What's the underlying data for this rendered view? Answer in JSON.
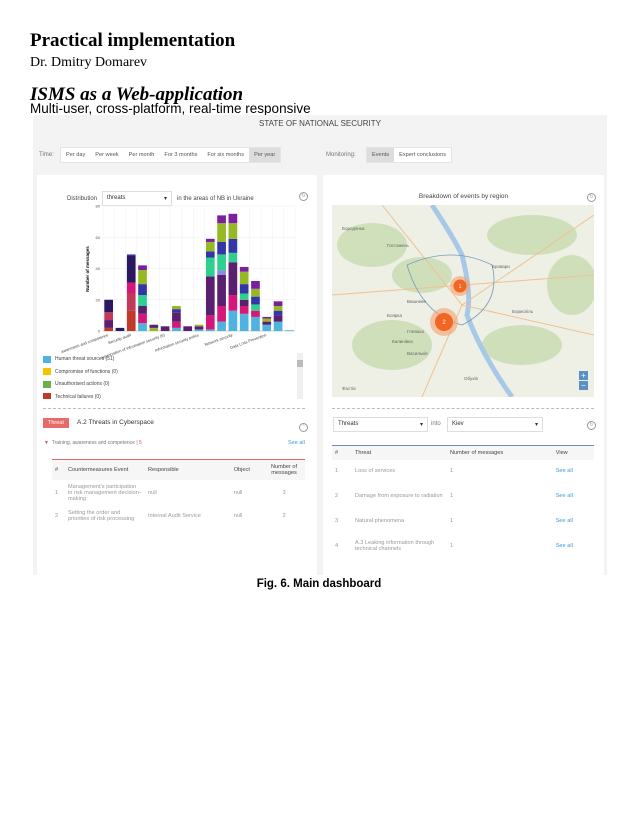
{
  "document": {
    "title": "Practical implementation",
    "author": "Dr. Dmitry Domarev",
    "section": "ISMS as a Web-application",
    "subtitle": "Multi-user, cross-platform, real-time responsive",
    "caption": "Fig. 6. Main dashboard"
  },
  "dashboard": {
    "title": "STATE OF NATIONAL SECURITY",
    "time_label": "Time:",
    "time_options": [
      "Per day",
      "Per week",
      "Per month",
      "For 3 months",
      "For six months",
      "Per year"
    ],
    "time_selected": "Per year",
    "monitoring_label": "Monitoring:",
    "monitoring_options": [
      "Events",
      "Expert conclusions"
    ],
    "monitoring_selected": "Events"
  },
  "distribution": {
    "prefix": "Distribution",
    "select_value": "threats",
    "suffix": "in the areas of NB in Ukraine",
    "legend": [
      {
        "label": "Human threat sources (51)",
        "color": "#4fb3e0"
      },
      {
        "label": "Compromise of functions (0)",
        "color": "#f5c400"
      },
      {
        "label": "Unauthorised actions (0)",
        "color": "#6ab04c"
      },
      {
        "label": "Technical failures (0)",
        "color": "#c0392b"
      }
    ]
  },
  "chart_data": {
    "type": "bar",
    "stacked": true,
    "ylabel": "Number of messages",
    "ylim": [
      0,
      80
    ],
    "yticks": [
      0,
      20,
      40,
      60,
      80
    ],
    "grid": true,
    "categories": [
      "awareness and competence",
      "",
      "Security audit",
      "",
      "",
      "organization of information security (6)",
      "",
      "",
      "Information security policy",
      "",
      "",
      "Network security",
      "",
      "",
      "Data Loss Prevention",
      "",
      ""
    ],
    "colors": {
      "lightblue": "#4fb3e0",
      "magenta": "#d6177a",
      "crimson": "#c23a5a",
      "red": "#c0392b",
      "darkpurple": "#5a1f6e",
      "navy": "#2c1860",
      "teal": "#2fd08f",
      "lavender": "#8c8ce0",
      "blue": "#3535a8",
      "olive": "#95b825",
      "purple": "#7a1fa0"
    },
    "bars": [
      [
        [
          "red",
          2
        ],
        [
          "darkpurple",
          5
        ],
        [
          "crimson",
          5
        ],
        [
          "navy",
          8
        ]
      ],
      [
        [
          "navy",
          2
        ]
      ],
      [
        [
          "red",
          13
        ],
        [
          "crimson",
          11
        ],
        [
          "magenta",
          7
        ],
        [
          "navy",
          17
        ],
        [
          "blue",
          1
        ]
      ],
      [
        [
          "lightblue",
          5
        ],
        [
          "magenta",
          6
        ],
        [
          "darkpurple",
          5
        ],
        [
          "teal",
          7
        ],
        [
          "blue",
          7
        ],
        [
          "olive",
          9
        ],
        [
          "purple",
          3
        ]
      ],
      [
        [
          "olive",
          2
        ],
        [
          "darkpurple",
          2
        ]
      ],
      [
        [
          "darkpurple",
          3
        ]
      ],
      [
        [
          "lightblue",
          2
        ],
        [
          "magenta",
          4
        ],
        [
          "darkpurple",
          6
        ],
        [
          "blue",
          2
        ],
        [
          "olive",
          2
        ]
      ],
      [
        [
          "darkpurple",
          3
        ]
      ],
      [
        [
          "lightblue",
          1
        ],
        [
          "darkpurple",
          2
        ],
        [
          "olive",
          1
        ]
      ],
      [
        [
          "lightblue",
          1
        ],
        [
          "magenta",
          9
        ],
        [
          "darkpurple",
          25
        ],
        [
          "teal",
          12
        ],
        [
          "blue",
          4
        ],
        [
          "olive",
          6
        ],
        [
          "purple",
          2
        ]
      ],
      [
        [
          "lightblue",
          6
        ],
        [
          "magenta",
          10
        ],
        [
          "darkpurple",
          20
        ],
        [
          "lavender",
          3
        ],
        [
          "teal",
          10
        ],
        [
          "blue",
          8
        ],
        [
          "olive",
          12
        ],
        [
          "purple",
          5
        ]
      ],
      [
        [
          "lightblue",
          13
        ],
        [
          "magenta",
          10
        ],
        [
          "darkpurple",
          21
        ],
        [
          "teal",
          6
        ],
        [
          "blue",
          9
        ],
        [
          "olive",
          10
        ],
        [
          "purple",
          6
        ]
      ],
      [
        [
          "lightblue",
          11
        ],
        [
          "magenta",
          5
        ],
        [
          "darkpurple",
          4
        ],
        [
          "teal",
          4
        ],
        [
          "blue",
          6
        ],
        [
          "olive",
          8
        ],
        [
          "purple",
          3
        ]
      ],
      [
        [
          "lightblue",
          9
        ],
        [
          "magenta",
          4
        ],
        [
          "teal",
          4
        ],
        [
          "blue",
          5
        ],
        [
          "olive",
          5
        ],
        [
          "purple",
          5
        ]
      ],
      [
        [
          "lightblue",
          4
        ],
        [
          "darkpurple",
          2
        ],
        [
          "olive",
          2
        ],
        [
          "purple",
          1
        ]
      ],
      [
        [
          "lightblue",
          6
        ],
        [
          "darkpurple",
          4
        ],
        [
          "blue",
          3
        ],
        [
          "olive",
          3
        ],
        [
          "purple",
          3
        ]
      ],
      [
        [
          "lightblue",
          0.5
        ]
      ]
    ]
  },
  "threat": {
    "badge": "Threat",
    "title": "A.2 Threats in Cyberspace",
    "group": "Training, awareness and competence |",
    "group_count": "5",
    "see_all": "See all",
    "headers": [
      "#",
      "Countermeasures Event",
      "Responsible",
      "Object",
      "Number of messages"
    ],
    "rows": [
      [
        "1",
        "Management's participation in risk management decision-making",
        "null",
        "null",
        "3"
      ],
      [
        "2",
        "Setting the order and priorities of risk processing",
        "Internal Audit Service",
        "null",
        "2"
      ]
    ]
  },
  "region": {
    "title": "Breakdown of events by region",
    "markers": [
      {
        "label": "1",
        "color": "#f26522"
      },
      {
        "label": "2",
        "color": "#f26522"
      }
    ],
    "map_places": [
      "Бородянка",
      "Гостомель",
      "Вишневе",
      "Боярка",
      "Бровари",
      "Бориспіль",
      "Васильків",
      "Обухів",
      "Фастів",
      "Калинівка",
      "Глеваха"
    ],
    "zoom_in": "+",
    "zoom_out": "−",
    "select1": "Threats",
    "into": "into",
    "select2": "Kiev",
    "headers": [
      "#",
      "Threat",
      "Number of messages",
      "View"
    ],
    "rows": [
      [
        "1",
        "Loss of services",
        "1",
        "See all"
      ],
      [
        "2",
        "Damage from exposure to radiation",
        "1",
        "See all"
      ],
      [
        "3",
        "Natural phenomena",
        "1",
        "See all"
      ],
      [
        "4",
        "A.3 Leaking information through technical channels",
        "1",
        "See all"
      ]
    ]
  }
}
